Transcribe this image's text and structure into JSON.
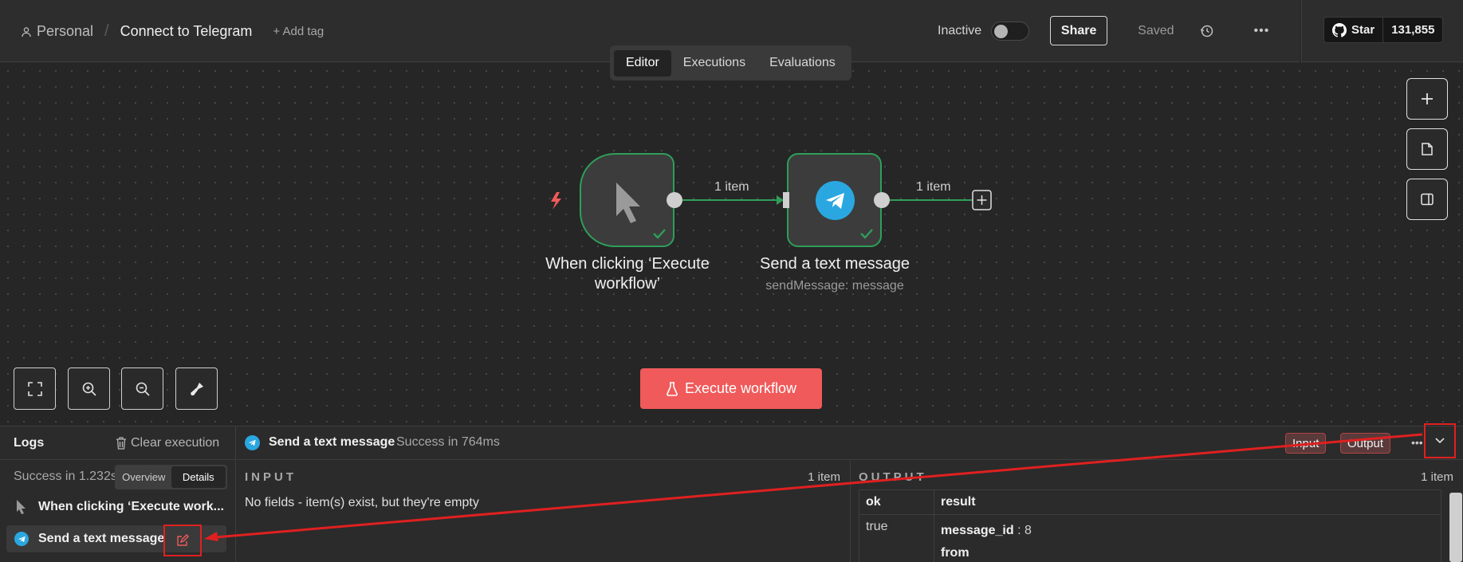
{
  "header": {
    "breadcrumb_root": "Personal",
    "workflow_name": "Connect to Telegram",
    "add_tag": "+ Add tag",
    "status_label": "Inactive",
    "share_label": "Share",
    "saved_label": "Saved",
    "github": {
      "star_label": "Star",
      "star_count": "131,855"
    }
  },
  "tabs": [
    {
      "label": "Editor",
      "active": true
    },
    {
      "label": "Executions",
      "active": false
    },
    {
      "label": "Evaluations",
      "active": false
    }
  ],
  "canvas": {
    "nodes": [
      {
        "name": "When clicking ‘Execute workflow’",
        "line1": "When clicking ‘Execute",
        "line2": "workflow’",
        "icon": "pointer-icon",
        "status": "success"
      },
      {
        "name": "Send a text message",
        "subtitle": "sendMessage: message",
        "icon": "telegram-icon",
        "status": "success"
      }
    ],
    "edges": [
      {
        "label": "1 item"
      },
      {
        "label": "1 item"
      }
    ],
    "execute_button": "Execute workflow",
    "side_buttons": [
      "plus-icon",
      "sticky-note-icon",
      "panel-icon"
    ],
    "zoom_buttons": [
      "fit-view-icon",
      "zoom-in-icon",
      "zoom-out-icon",
      "tidy-up-icon"
    ]
  },
  "logs": {
    "title": "Logs",
    "clear_label": "Clear execution",
    "summary": "Success in 1.232s",
    "view_toggle": [
      {
        "label": "Overview",
        "active": false
      },
      {
        "label": "Details",
        "active": true
      }
    ],
    "items": [
      {
        "label": "When clicking ‘Execute work...",
        "icon": "pointer-icon",
        "selected": false
      },
      {
        "label": "Send a text message",
        "icon": "telegram-icon",
        "selected": true
      }
    ],
    "detail": {
      "node_name": "Send a text message",
      "status": "Success in 764ms",
      "input_btn": "Input",
      "output_btn": "Output",
      "input": {
        "title": "INPUT",
        "count": "1 item",
        "message": "No fields - item(s) exist, but they're empty"
      },
      "output": {
        "title": "OUTPUT",
        "count": "1 item",
        "columns": [
          "ok",
          "result"
        ],
        "ok_value": "true",
        "result_key1": "message_id",
        "result_val1": ": 8",
        "result_key2": "from"
      }
    }
  },
  "colors": {
    "accent": "#f05a5a",
    "success": "#2f9e5a",
    "telegram": "#2aa7e0",
    "annotation": "#e02020"
  }
}
